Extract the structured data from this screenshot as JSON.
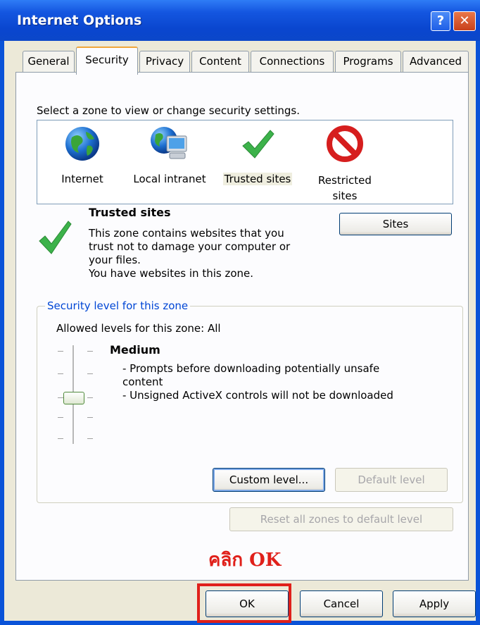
{
  "window": {
    "title": "Internet Options",
    "help_glyph": "?",
    "close_glyph": "✕"
  },
  "tabs": [
    {
      "label": "General"
    },
    {
      "label": "Security"
    },
    {
      "label": "Privacy"
    },
    {
      "label": "Content"
    },
    {
      "label": "Connections"
    },
    {
      "label": "Programs"
    },
    {
      "label": "Advanced"
    }
  ],
  "zone_prompt": "Select a zone to view or change security settings.",
  "zones": [
    {
      "label": "Internet",
      "icon": "globe-icon"
    },
    {
      "label": "Local intranet",
      "icon": "intranet-icon"
    },
    {
      "label": "Trusted sites",
      "icon": "checkmark-icon"
    },
    {
      "label_line1": "Restricted",
      "label_line2": "sites",
      "icon": "restricted-icon"
    }
  ],
  "selected_zone": {
    "title": "Trusted sites",
    "desc_line1": "This zone contains websites that you",
    "desc_line2": "trust not to damage your computer or",
    "desc_line3": "your files.",
    "desc_line4": "You have websites in this zone."
  },
  "sites_button": "Sites",
  "security_group": {
    "legend": "Security level for this zone",
    "allowed": "Allowed levels for this zone: All",
    "level_name": "Medium",
    "bullet1_line1": "- Prompts before downloading potentially unsafe",
    "bullet1_line2": "content",
    "bullet2": "- Unsigned ActiveX controls will not be downloaded",
    "slider_level": "Medium"
  },
  "buttons": {
    "custom_level": "Custom level...",
    "default_level": "Default level",
    "reset_all": "Reset all zones to default level",
    "ok": "OK",
    "cancel": "Cancel",
    "apply": "Apply"
  },
  "annotation": {
    "text": "คลิก OK",
    "color": "#e0201a"
  },
  "colors": {
    "title_bar": "#0a46cf",
    "dialog_bg": "#ece9d8",
    "highlight": "#e0201a"
  }
}
